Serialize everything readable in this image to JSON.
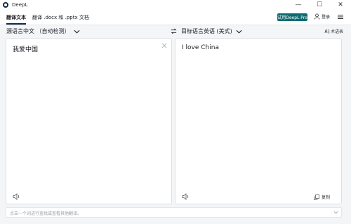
{
  "window": {
    "title": "DeepL",
    "minimize_glyph": "—",
    "maximize_glyph": "☐",
    "close_glyph": "✕"
  },
  "menu": {
    "tabs": [
      {
        "label": "翻译文本",
        "active": true
      },
      {
        "label": "翻译 .docx 和 .pptx 文档",
        "active": false
      }
    ],
    "pro_button": "试用DeepL Pro",
    "login": "登录"
  },
  "languages": {
    "source": "源语言中文 （自动检测）",
    "target": "目标语言英语 (美式)",
    "glossary": "术语表"
  },
  "source_panel": {
    "text": "我爱中国"
  },
  "target_panel": {
    "text": "I love China",
    "copy_label": "复制"
  },
  "hint": {
    "text": "点击一个词进行查找或查看其他翻译。"
  },
  "icons": {
    "logo": "deepl-logo",
    "user": "user-icon",
    "menu": "hamburger-menu-icon",
    "swap": "swap-arrows-icon",
    "clear": "close-icon",
    "speaker": "speaker-icon",
    "copy": "copy-icon"
  },
  "colors": {
    "accent": "#0f6b72",
    "brand_dark": "#0f2b46",
    "background": "#f3f5f7"
  }
}
